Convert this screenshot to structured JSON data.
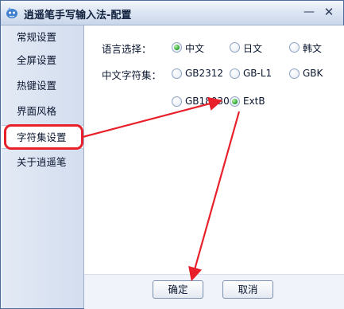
{
  "window": {
    "title": "逍遥笔手写输入法-配置",
    "minimize_glyph": "—",
    "close_glyph": "✕"
  },
  "sidebar": {
    "items": [
      {
        "label": "常规设置"
      },
      {
        "label": "全屏设置"
      },
      {
        "label": "热键设置"
      },
      {
        "label": "界面风格"
      },
      {
        "label": "字符集设置",
        "selected": true
      },
      {
        "label": "关于逍遥笔"
      }
    ]
  },
  "content": {
    "language": {
      "label": "语言选择：",
      "options": [
        {
          "label": "中文",
          "checked": true
        },
        {
          "label": "日文",
          "checked": false
        },
        {
          "label": "韩文",
          "checked": false
        }
      ]
    },
    "charset": {
      "label": "中文字符集：",
      "options": [
        {
          "label": "GB2312",
          "checked": false
        },
        {
          "label": "GB-L1",
          "checked": false
        },
        {
          "label": "GBK",
          "checked": false
        },
        {
          "label": "GB18030",
          "checked": false
        },
        {
          "label": "ExtB",
          "checked": true
        }
      ]
    }
  },
  "buttons": {
    "ok": "确定",
    "cancel": "取消"
  },
  "annotation": {
    "color": "#e8202a"
  }
}
